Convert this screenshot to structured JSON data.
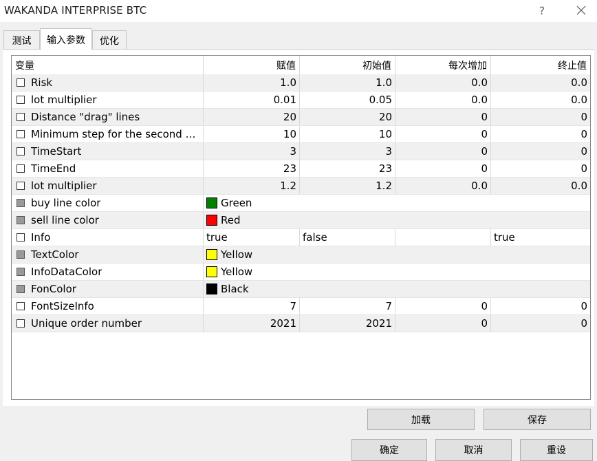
{
  "window": {
    "title": "WAKANDA INTERPRISE BTC",
    "help_glyph": "?"
  },
  "tabs": [
    "测试",
    "输入参数",
    "优化"
  ],
  "table": {
    "headers": [
      "变量",
      "赋值",
      "初始值",
      "每次增加",
      "终止值"
    ],
    "rows": [
      {
        "name": "Risk",
        "checkbox": "white",
        "cells": [
          "1.0",
          "1.0",
          "0.0",
          "0.0"
        ]
      },
      {
        "name": "lot multiplier",
        "checkbox": "white",
        "cells": [
          "0.01",
          "0.05",
          "0.0",
          "0.0"
        ]
      },
      {
        "name": "Distance \"drag\" lines",
        "checkbox": "white",
        "cells": [
          "20",
          "20",
          "0",
          "0"
        ]
      },
      {
        "name": "Minimum step for the second a...",
        "checkbox": "white",
        "cells": [
          "10",
          "10",
          "0",
          "0"
        ]
      },
      {
        "name": "TimeStart",
        "checkbox": "white",
        "cells": [
          "3",
          "3",
          "0",
          "0"
        ]
      },
      {
        "name": "TimeEnd",
        "checkbox": "white",
        "cells": [
          "23",
          "23",
          "0",
          "0"
        ]
      },
      {
        "name": "lot multiplier",
        "checkbox": "white",
        "cells": [
          "1.2",
          "1.2",
          "0.0",
          "0.0"
        ]
      },
      {
        "name": "buy line color",
        "checkbox": "grey",
        "color": {
          "label": "Green",
          "hex": "#008000"
        }
      },
      {
        "name": "sell line color",
        "checkbox": "grey",
        "color": {
          "label": "Red",
          "hex": "#ff0000"
        }
      },
      {
        "name": "Info",
        "checkbox": "white",
        "bool": true,
        "cells": [
          "true",
          "false",
          "",
          "true"
        ]
      },
      {
        "name": "TextColor",
        "checkbox": "grey",
        "color": {
          "label": "Yellow",
          "hex": "#ffff00"
        }
      },
      {
        "name": "InfoDataColor",
        "checkbox": "grey",
        "color": {
          "label": "Yellow",
          "hex": "#ffff00"
        }
      },
      {
        "name": "FonColor",
        "checkbox": "grey",
        "color": {
          "label": "Black",
          "hex": "#000000"
        }
      },
      {
        "name": "FontSizeInfo",
        "checkbox": "white",
        "cells": [
          "7",
          "7",
          "0",
          "0"
        ]
      },
      {
        "name": "Unique order number",
        "checkbox": "white",
        "cells": [
          "2021",
          "2021",
          "0",
          "0"
        ]
      }
    ]
  },
  "buttons": {
    "load": "加载",
    "save": "保存",
    "ok": "确定",
    "cancel": "取消",
    "reset": "重设"
  }
}
